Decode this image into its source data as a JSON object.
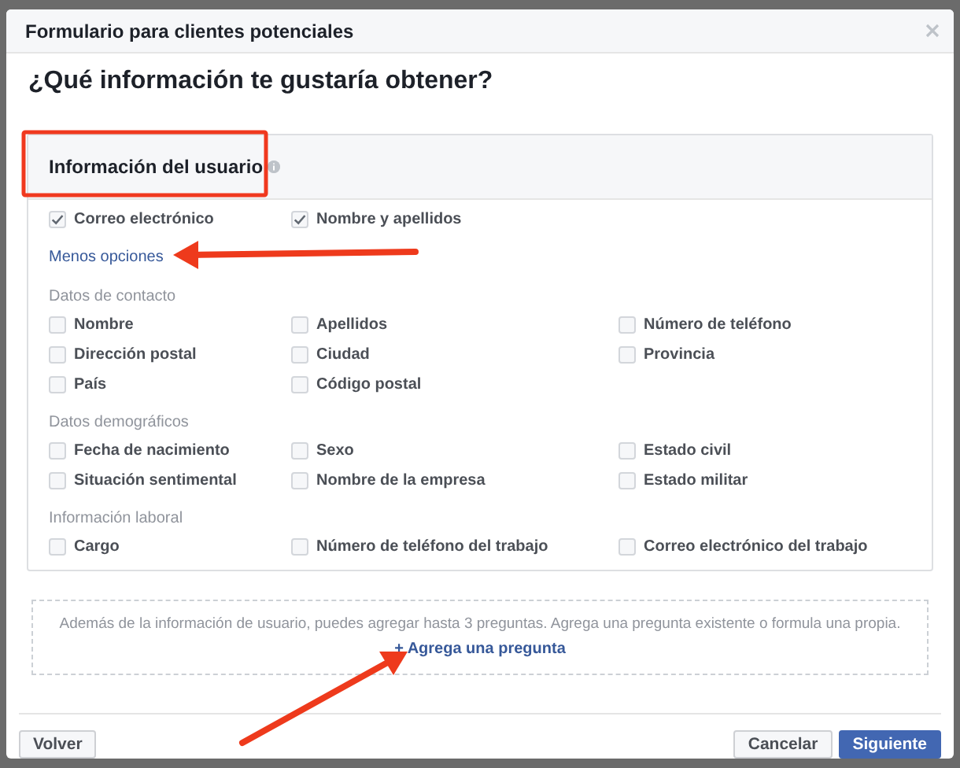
{
  "dialog": {
    "title": "Formulario para clientes potenciales",
    "heading": "¿Qué información te gustaría obtener?"
  },
  "section": {
    "title": "Información del usuario",
    "selected_fields": [
      {
        "label": "Correo electrónico",
        "checked": true
      },
      {
        "label": "Nombre y apellidos",
        "checked": true
      }
    ],
    "toggle_link": "Menos opciones",
    "groups": [
      {
        "title": "Datos de contacto",
        "fields": [
          {
            "label": "Nombre",
            "checked": false
          },
          {
            "label": "Apellidos",
            "checked": false
          },
          {
            "label": "Número de teléfono",
            "checked": false
          },
          {
            "label": "Dirección postal",
            "checked": false
          },
          {
            "label": "Ciudad",
            "checked": false
          },
          {
            "label": "Provincia",
            "checked": false
          },
          {
            "label": "País",
            "checked": false
          },
          {
            "label": "Código postal",
            "checked": false
          }
        ]
      },
      {
        "title": "Datos demográficos",
        "fields": [
          {
            "label": "Fecha de nacimiento",
            "checked": false
          },
          {
            "label": "Sexo",
            "checked": false
          },
          {
            "label": "Estado civil",
            "checked": false
          },
          {
            "label": "Situación sentimental",
            "checked": false
          },
          {
            "label": "Nombre de la empresa",
            "checked": false
          },
          {
            "label": "Estado militar",
            "checked": false
          }
        ]
      },
      {
        "title": "Información laboral",
        "fields": [
          {
            "label": "Cargo",
            "checked": false
          },
          {
            "label": "Número de teléfono del trabajo",
            "checked": false
          },
          {
            "label": "Correo electrónico del trabajo",
            "checked": false
          }
        ]
      }
    ]
  },
  "questions": {
    "note": "Además de la información de usuario, puedes agregar hasta 3 preguntas. Agrega una pregunta existente o formula una propia.",
    "add_link": "+ Agrega una pregunta"
  },
  "footer": {
    "back_button": "Volver",
    "cancel_button": "Cancelar",
    "next_button": "Siguiente"
  }
}
